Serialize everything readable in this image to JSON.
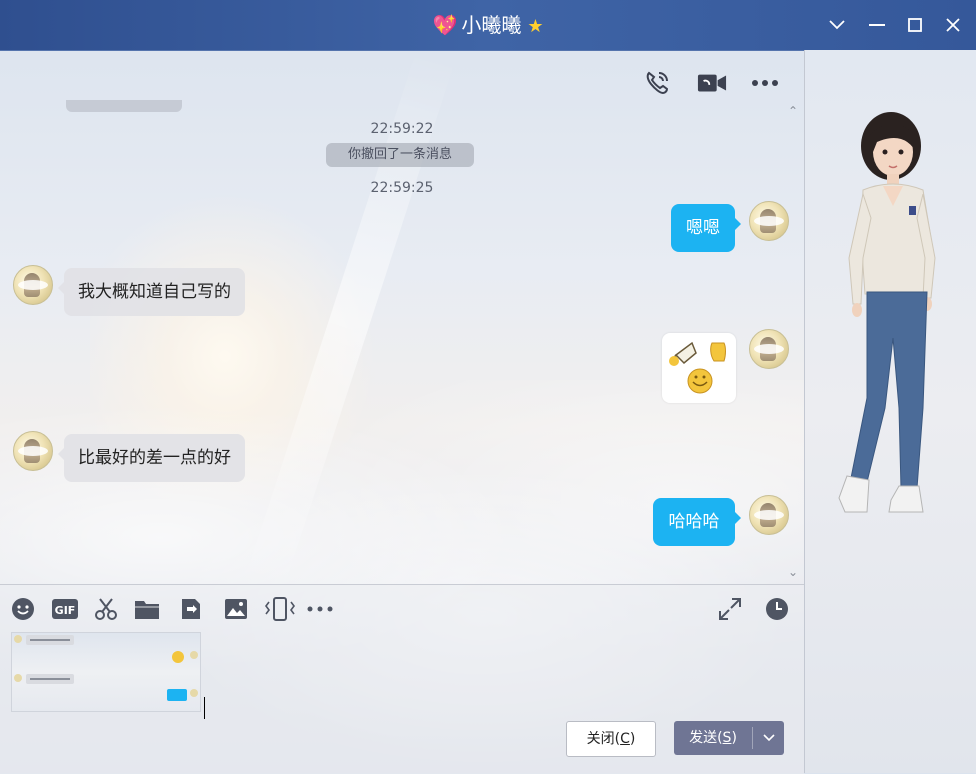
{
  "window": {
    "title": "小曦曦",
    "controls": [
      "chevron-down-icon",
      "minimize-icon",
      "maximize-icon",
      "close-icon"
    ]
  },
  "chat_header": {
    "icons": [
      "phone-call-icon",
      "video-call-icon",
      "more-icon"
    ]
  },
  "messages": {
    "time1": "22:59:22",
    "recall_notice": "你撤回了一条消息",
    "time2": "22:59:25",
    "msg1": "嗯嗯",
    "msg2": "我大概知道自己写的",
    "msg4": "比最好的差一点的好",
    "msg5": "哈哈哈"
  },
  "toolbar": {
    "icons": [
      "emoji-icon",
      "gif-icon",
      "screenshot-scissors-icon",
      "folder-icon",
      "file-transfer-icon",
      "image-icon",
      "shake-window-icon",
      "more-tools-icon"
    ],
    "right_icons": [
      "expand-icon",
      "history-clock-icon"
    ]
  },
  "buttons": {
    "close_label": "关闭(",
    "close_key": "C",
    "close_end": ")",
    "send_label": "发送(",
    "send_key": "S",
    "send_end": ")"
  },
  "colors": {
    "titlebar": "#35589a",
    "my_bubble": "#1cb3f2",
    "other_bubble": "#e1e2e6",
    "send_button": "#6f7594"
  }
}
